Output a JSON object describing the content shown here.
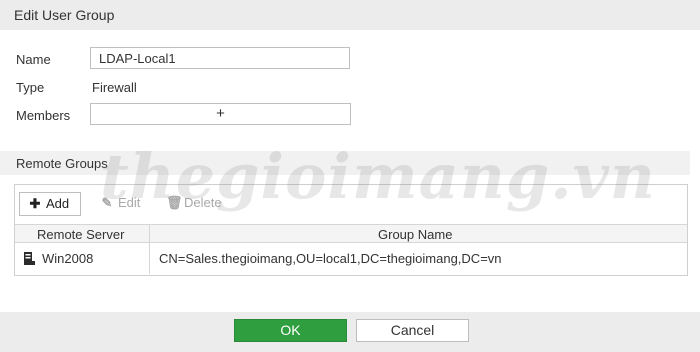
{
  "dialog": {
    "title": "Edit User Group"
  },
  "form": {
    "name_label": "Name",
    "name_value": "LDAP-Local1",
    "type_label": "Type",
    "type_value": "Firewall",
    "members_label": "Members",
    "members_add_glyph": "+"
  },
  "remote_groups": {
    "title": "Remote Groups",
    "toolbar": {
      "add": "Add",
      "edit": "Edit",
      "delete": "Delete"
    },
    "columns": [
      "Remote Server",
      "Group Name"
    ],
    "rows": [
      {
        "server": "Win2008",
        "group": "CN=Sales.thegioimang,OU=local1,DC=thegioimang,DC=vn"
      }
    ]
  },
  "buttons": {
    "ok": "OK",
    "cancel": "Cancel"
  },
  "watermark": "thegioimang.vn",
  "colors": {
    "ok_green": "#2f9e3f",
    "header_gray": "#ececec"
  }
}
